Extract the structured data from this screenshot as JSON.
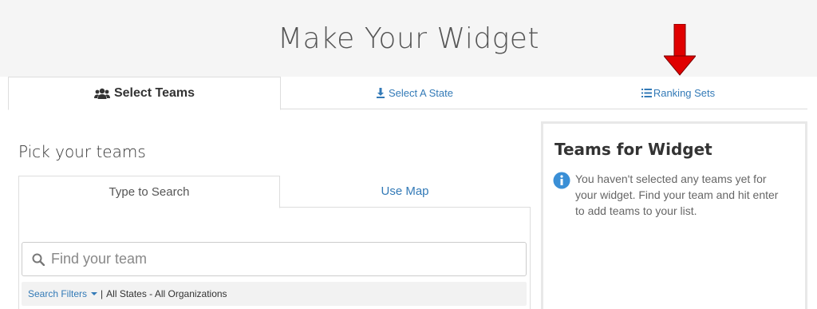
{
  "header": {
    "title": "Make Your Widget"
  },
  "main_tabs": [
    {
      "label": "Select Teams",
      "icon": "users-icon",
      "active": true
    },
    {
      "label": "Select A State",
      "icon": "map-pin-icon",
      "active": false
    },
    {
      "label": "Ranking Sets",
      "icon": "list-icon",
      "active": false
    }
  ],
  "left": {
    "section_title": "Pick your teams",
    "sub_tabs": [
      {
        "label": "Type to Search",
        "active": true
      },
      {
        "label": "Use Map",
        "active": false
      }
    ],
    "search": {
      "placeholder": "Find your team",
      "value": ""
    },
    "filters": {
      "link_label": "Search Filters",
      "separator": "|",
      "summary": "All States - All Organizations"
    }
  },
  "right": {
    "title": "Teams for Widget",
    "info_text": "You haven't selected any teams yet for your widget. Find your team and hit enter to add teams to your list."
  },
  "colors": {
    "link": "#337ab7",
    "arrow": "#e00000",
    "info": "#3a8fd6"
  }
}
